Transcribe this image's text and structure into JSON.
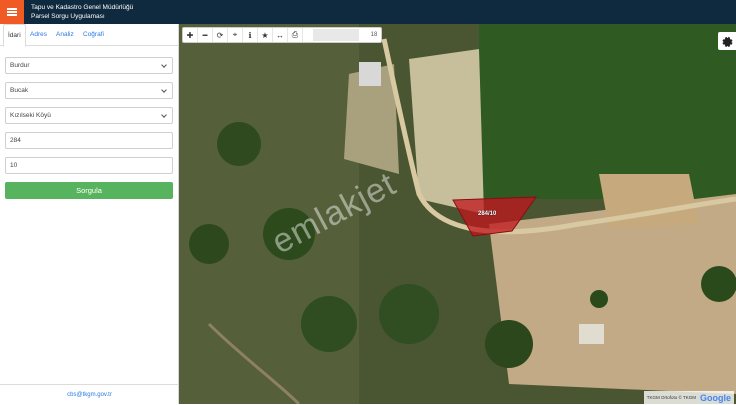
{
  "header": {
    "title_line1": "Tapu ve Kadastro Genel Müdürlüğü",
    "title_line2": "Parsel Sorgu Uygulaması"
  },
  "sidebar": {
    "tabs": [
      {
        "label": "İdari"
      },
      {
        "label": "Adres"
      },
      {
        "label": "Analiz"
      },
      {
        "label": "Coğrafi"
      }
    ],
    "province": "Burdur",
    "district": "Bucak",
    "neighborhood": "Kızılseki Köyü",
    "block_no": "284",
    "parcel_no": "10",
    "query_label": "Sorgula",
    "footer_email": "cbs@tkgm.gov.tr"
  },
  "map": {
    "toolbar_icons": [
      "plus-icon",
      "minus-icon",
      "refresh-icon",
      "locate-icon",
      "info-icon",
      "star-icon",
      "measure-icon",
      "print-icon"
    ],
    "zoom_level": "18",
    "parcel_label": "284/10",
    "watermark": "emlakjet",
    "attribution": "TKGM Ortofoto © TKGM",
    "google_logo": "Google",
    "colors": {
      "parcel_fill": "#c0151c",
      "header_bg": "#0f2a3f",
      "menu_bg": "#f05a24",
      "button_green": "#58b35e"
    }
  }
}
